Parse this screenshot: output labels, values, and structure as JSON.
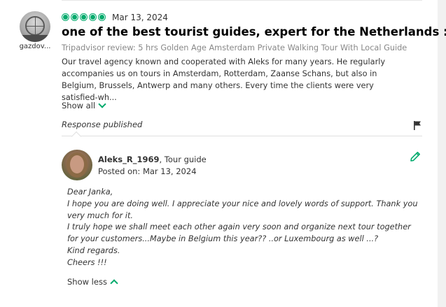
{
  "review": {
    "reviewer_name": "gazdov...",
    "rating": 5,
    "date": "Mar 13, 2024",
    "title": "one of the best tourist guides, expert for the Netherlands :-)",
    "source": "Tripadvisor review: 5 hrs Golden Age Amsterdam Private Walking Tour With Local Guide",
    "body": "Our travel agency known and cooperated with Aleks for many years. He regularly accompanies us on tours in Amsterdam, Rotterdam, Zaanse Schans, but also in Belgium, Brussels, Antwerp and many others. Every time the clients were very satisfied-wh...",
    "show_all_label": "Show all"
  },
  "response": {
    "status_label": "Response published",
    "owner_name": "Aleks_R_1969",
    "owner_role": ", Tour guide",
    "posted_on": "Posted on: Mar 13, 2024",
    "lines": [
      "Dear Janka,",
      "I hope you are doing well. I appreciate your nice and lovely words of support. Thank you very much for it.",
      "I truly hope we shall meet each other again very soon and organize next tour together for your customers...Maybe in Belgium this year?? ..or Luxembourg as well ...?",
      "Kind regards.",
      "Cheers !!!"
    ],
    "show_less_label": "Show less"
  },
  "icons": {
    "rating": "rating-bubble-icon",
    "flag": "flag-icon",
    "edit": "pencil-icon",
    "chevron_down": "chevron-down-icon",
    "chevron_up": "chevron-up-icon"
  },
  "colors": {
    "accent": "#00aa6c",
    "text": "#333333",
    "muted": "#888888"
  }
}
